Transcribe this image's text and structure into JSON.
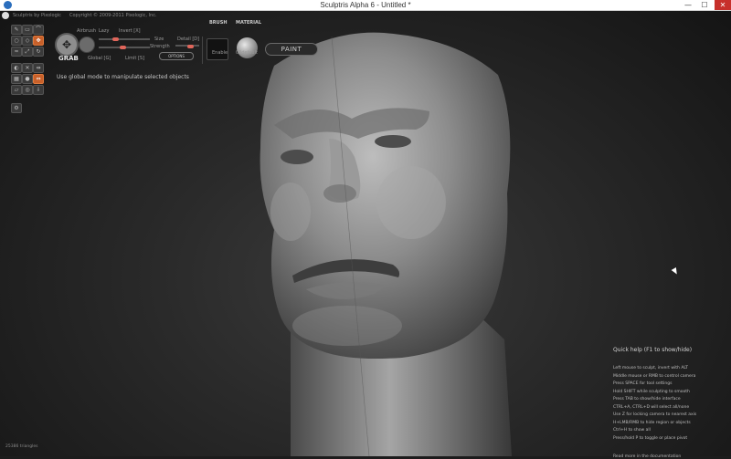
{
  "window": {
    "title": "Sculptris Alpha 6 - Untitled *",
    "minimize": "—",
    "maximize": "☐",
    "close": "✕"
  },
  "header": {
    "app_caption": "Sculptris by Pixologic",
    "copyright": "Copyright © 2009-2011 Pixologic, Inc."
  },
  "tools": {
    "active_tool": "GRAB",
    "airbrush": "Airbrush",
    "lazy": "Lazy",
    "invert": "Invert [X]",
    "size": "Size",
    "detail": "Detail [D]",
    "strength": "Strength",
    "global": "Global [G]",
    "limit": "Limit [S]",
    "options": "OPTIONS"
  },
  "brush": {
    "label": "BRUSH",
    "enable": "Enable"
  },
  "material": {
    "label": "MATERIAL",
    "name": "00default"
  },
  "paint_button": "PAINT",
  "hint": "Use global mode to manipulate selected objects",
  "quick_help": {
    "title": "Quick help (F1 to show/hide)",
    "lines": [
      "Left mouse to sculpt, invert with ALT",
      "Middle mouse or RMB to control camera",
      "Press SPACE for tool settings",
      "Hold SHIFT while sculpting to smooth",
      "Press TAB to show/hide interface",
      "CTRL+A, CTRL+D will select all/none",
      "Use Z for locking camera to nearest axis",
      "H+LMB/RMB to hide region or objects",
      "Ctrl+H to show all",
      "Press/hold P to toggle or place pivot"
    ],
    "footer": "Read more in the documentation"
  },
  "status": {
    "triangles": "25386 triangles"
  },
  "colors": {
    "accent": "#c8602a",
    "slider_knob": "#e0665b",
    "background": "#2a2a2a"
  }
}
